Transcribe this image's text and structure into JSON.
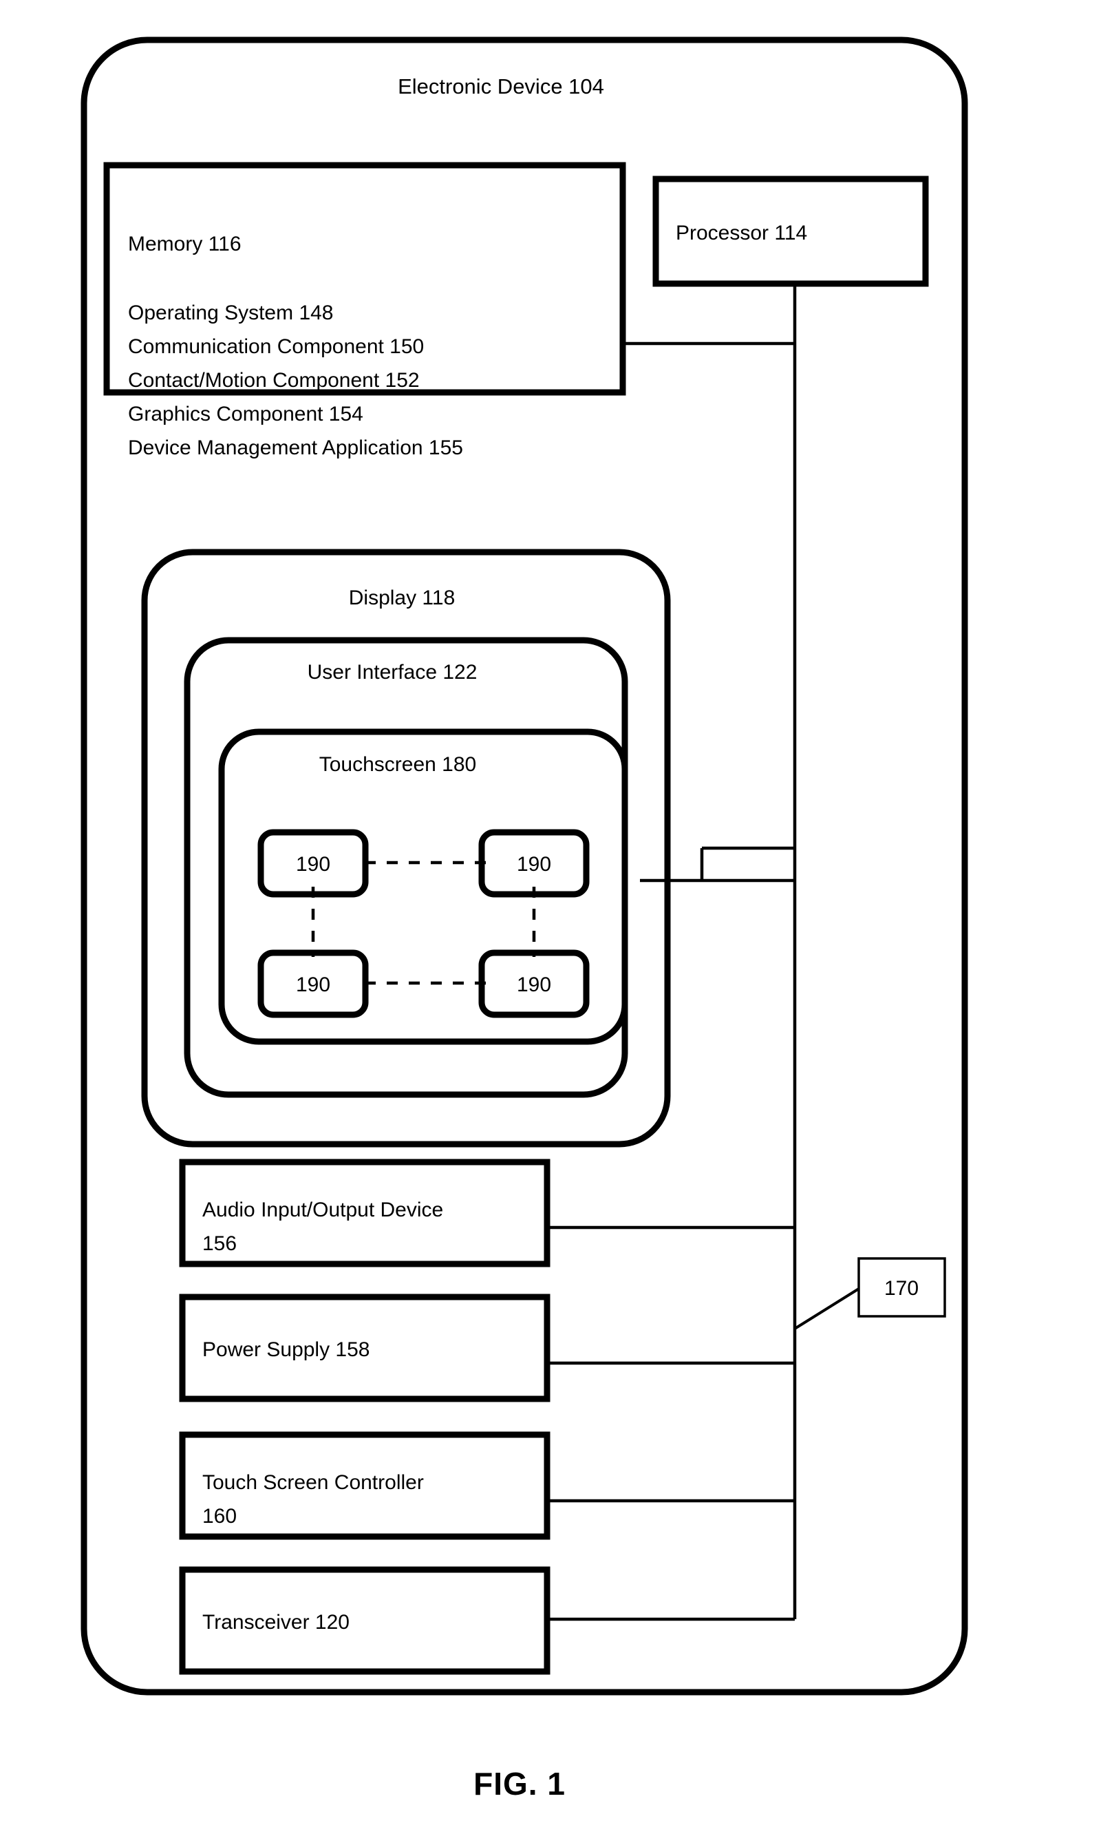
{
  "figure": {
    "caption": "FIG. 1",
    "device_title": "Electronic Device 104"
  },
  "memory": {
    "title": "Memory 116",
    "items": [
      "Operating System 148",
      "Communication Component 150",
      "Contact/Motion Component 152",
      "Graphics Component 154",
      "Device Management  Application 155"
    ]
  },
  "processor": {
    "label": "Processor 114"
  },
  "display_stack": {
    "display_label": "Display 118",
    "user_interface_label": "User Interface 122",
    "touchscreen_label": "Touchscreen 180",
    "nodes": [
      {
        "label": "190"
      },
      {
        "label": "190"
      },
      {
        "label": "190"
      },
      {
        "label": "190"
      }
    ]
  },
  "peripherals": [
    {
      "label_line1": "Audio Input/Output Device",
      "label_line2": "156"
    },
    {
      "label_line1": "Power Supply 158",
      "label_line2": ""
    },
    {
      "label_line1": "Touch Screen Controller",
      "label_line2": "160"
    },
    {
      "label_line1": "Transceiver 120",
      "label_line2": ""
    }
  ],
  "bus": {
    "label": "170"
  },
  "colors": {
    "ink": "#000000",
    "background": "#ffffff"
  }
}
